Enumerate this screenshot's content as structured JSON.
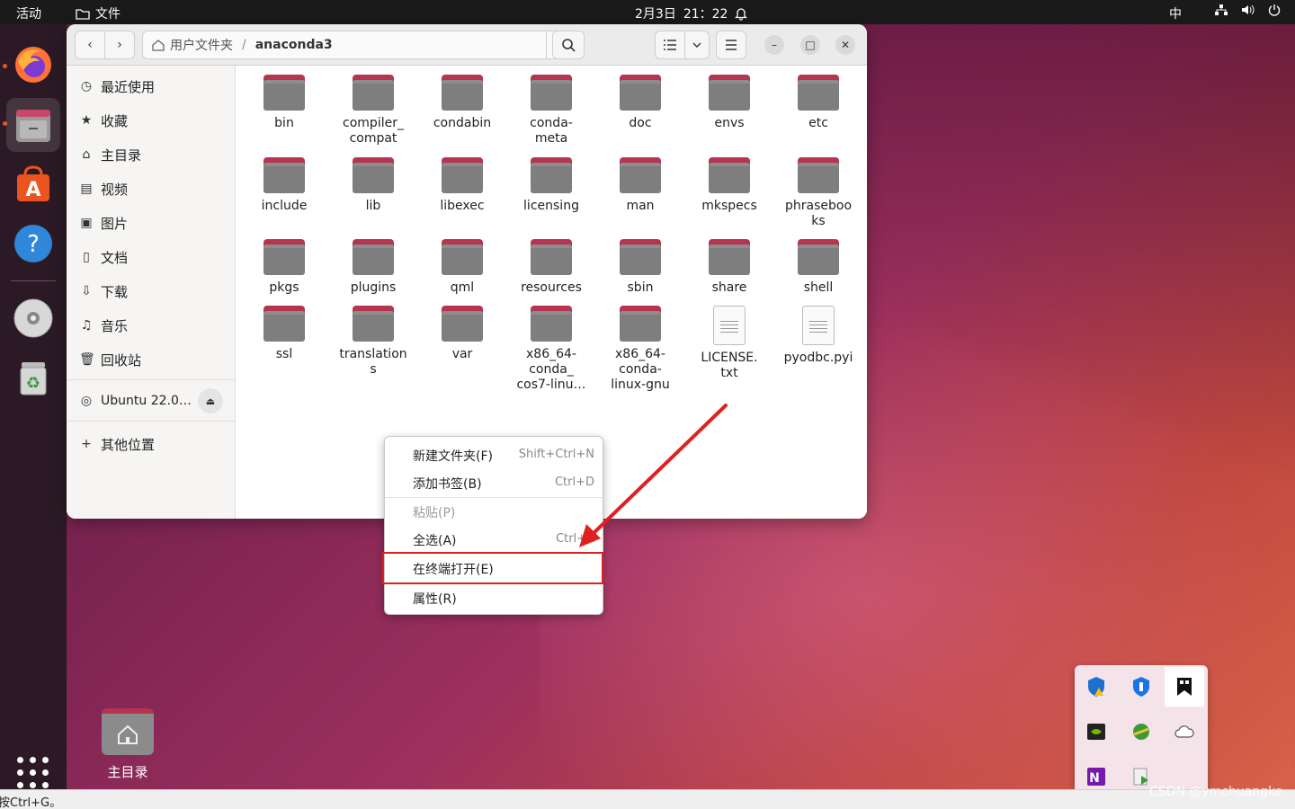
{
  "topbar": {
    "activities": "活动",
    "app_name": "文件",
    "date": "2月3日",
    "time": "21：22",
    "ime": "中"
  },
  "window": {
    "path_home": "用户文件夹",
    "path_sep": "/",
    "path_current": "anaconda3"
  },
  "sidebar": {
    "items": [
      {
        "label": "最近使用",
        "icon": "clock-icon"
      },
      {
        "label": "收藏",
        "icon": "star-icon"
      },
      {
        "label": "主目录",
        "icon": "home-icon"
      },
      {
        "label": "视频",
        "icon": "film-icon"
      },
      {
        "label": "图片",
        "icon": "image-icon"
      },
      {
        "label": "文档",
        "icon": "document-icon"
      },
      {
        "label": "下载",
        "icon": "download-icon"
      },
      {
        "label": "音乐",
        "icon": "music-icon"
      },
      {
        "label": "回收站",
        "icon": "trash-icon"
      }
    ],
    "device": "Ubuntu 22.0…",
    "other": "其他位置"
  },
  "files": [
    {
      "name": "bin",
      "type": "folder"
    },
    {
      "name": "compiler_\ncompat",
      "type": "folder"
    },
    {
      "name": "condabin",
      "type": "folder"
    },
    {
      "name": "conda-\nmeta",
      "type": "folder"
    },
    {
      "name": "doc",
      "type": "folder"
    },
    {
      "name": "envs",
      "type": "folder"
    },
    {
      "name": "etc",
      "type": "folder"
    },
    {
      "name": "include",
      "type": "folder"
    },
    {
      "name": "lib",
      "type": "folder"
    },
    {
      "name": "libexec",
      "type": "folder"
    },
    {
      "name": "licensing",
      "type": "folder"
    },
    {
      "name": "man",
      "type": "folder"
    },
    {
      "name": "mkspecs",
      "type": "folder"
    },
    {
      "name": "phraseboo\nks",
      "type": "folder"
    },
    {
      "name": "pkgs",
      "type": "folder"
    },
    {
      "name": "plugins",
      "type": "folder"
    },
    {
      "name": "qml",
      "type": "folder"
    },
    {
      "name": "resources",
      "type": "folder"
    },
    {
      "name": "sbin",
      "type": "folder"
    },
    {
      "name": "share",
      "type": "folder"
    },
    {
      "name": "shell",
      "type": "folder"
    },
    {
      "name": "ssl",
      "type": "folder"
    },
    {
      "name": "translation\ns",
      "type": "folder"
    },
    {
      "name": "var",
      "type": "folder"
    },
    {
      "name": "x86_64-\nconda_\ncos7-linu…",
      "type": "folder"
    },
    {
      "name": "x86_64-\nconda-\nlinux-gnu",
      "type": "folder"
    },
    {
      "name": "LICENSE.\ntxt",
      "type": "file"
    },
    {
      "name": "pyodbc.pyi",
      "type": "file"
    }
  ],
  "context_menu": {
    "items": [
      {
        "label": "新建文件夹(F)",
        "shortcut": "Shift+Ctrl+N",
        "enabled": true
      },
      {
        "label": "添加书签(B)",
        "shortcut": "Ctrl+D",
        "enabled": true
      },
      {
        "label": "粘贴(P)",
        "shortcut": "",
        "enabled": false
      },
      {
        "label": "全选(A)",
        "shortcut": "Ctrl+A",
        "enabled": true
      },
      {
        "label": "在终端打开(E)",
        "shortcut": "",
        "enabled": true,
        "highlighted": true
      },
      {
        "label": "属性(R)",
        "shortcut": "",
        "enabled": true
      }
    ]
  },
  "desktop": {
    "home_label": "主目录"
  },
  "bottombar": {
    "hint": "按Ctrl+G。",
    "watermark": "CSDN @ymchuangke"
  },
  "colors": {
    "accent": "#e95420",
    "folder_tab": "#b6344f",
    "highlight_border": "#e02020"
  }
}
